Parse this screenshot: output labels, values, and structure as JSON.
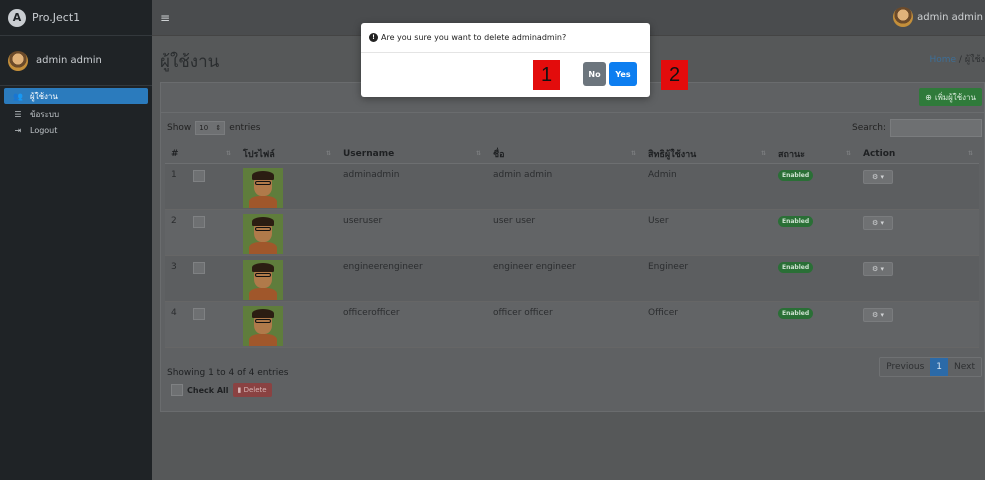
{
  "brand": {
    "logo_letter": "A",
    "name": "Pro.Ject1"
  },
  "user_panel": {
    "name": "admin admin"
  },
  "sidebar": {
    "items": [
      {
        "icon": "users-icon",
        "label": "ผู้ใช้งาน",
        "active": true
      },
      {
        "icon": "list-icon",
        "label": "ข้อระบบ",
        "active": false
      },
      {
        "icon": "logout-icon",
        "label": "Logout",
        "active": false
      }
    ]
  },
  "topbar": {
    "menu_icon": "≡",
    "user_name": "admin admin"
  },
  "page": {
    "title": "ผู้ใช้งาน",
    "breadcrumb_home": "Home",
    "breadcrumb_sep": "/",
    "breadcrumb_current": "ผู้ใช้ง"
  },
  "card": {
    "add_button": "เพิ่มผู้ใช้งาน",
    "show_label": "Show",
    "length_value": "10",
    "entries_label": "entries",
    "search_label": "Search:",
    "search_value": ""
  },
  "table": {
    "columns": [
      "#",
      "",
      "โปรไฟล์",
      "Username",
      "ชื่อ",
      "สิทธิผู้ใช้งาน",
      "สถานะ",
      "Action"
    ],
    "rows": [
      {
        "num": "1",
        "username": "adminadmin",
        "name": "admin admin",
        "role": "Admin",
        "status": "Enabled"
      },
      {
        "num": "2",
        "username": "useruser",
        "name": "user user",
        "role": "User",
        "status": "Enabled"
      },
      {
        "num": "3",
        "username": "engineerengineer",
        "name": "engineer engineer",
        "role": "Engineer",
        "status": "Enabled"
      },
      {
        "num": "4",
        "username": "officerofficer",
        "name": "officer officer",
        "role": "Officer",
        "status": "Enabled"
      }
    ]
  },
  "footer": {
    "info": "Showing 1 to 4 of 4 entries",
    "check_all": "Check All",
    "delete": "Delete",
    "pager_previous": "Previous",
    "pager_current": "1",
    "pager_next": "Next"
  },
  "modal": {
    "message": "Are you sure you want to delete adminadmin?",
    "no": "No",
    "yes": "Yes"
  },
  "markers": {
    "first": "1",
    "second": "2"
  },
  "colors": {
    "modal_yes": "#0d7ef0",
    "modal_no": "#6c757d",
    "marker": "#e30c0c",
    "active_nav": "#2b7bbd"
  }
}
